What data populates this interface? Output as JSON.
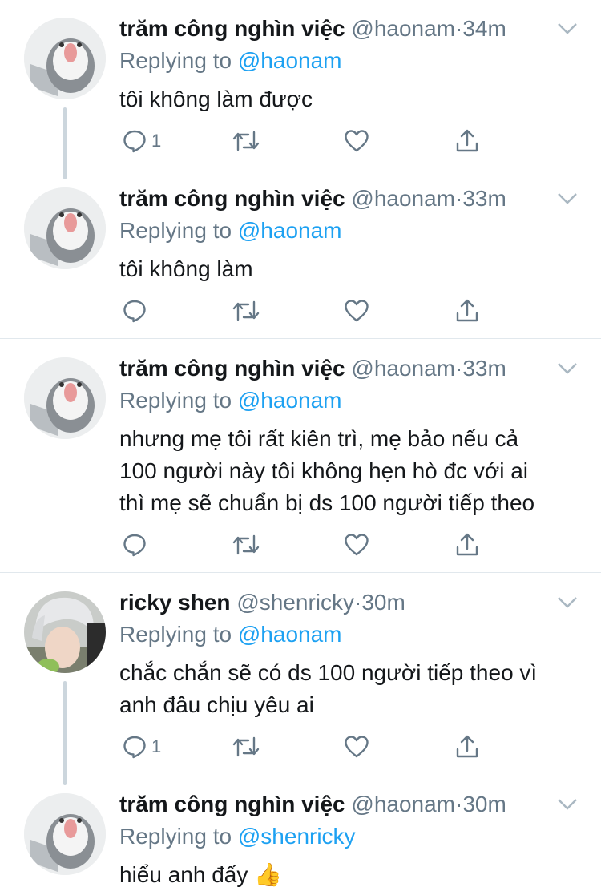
{
  "colors": {
    "text": "#14171a",
    "secondary": "#657786",
    "link": "#1da1f2",
    "divider": "#e1e8ed",
    "thread_line": "#ccd6dd"
  },
  "icons": {
    "reply": "reply-icon",
    "retweet": "retweet-icon",
    "like": "heart-icon",
    "share": "share-icon",
    "caret": "chevron-down-icon"
  },
  "tweets": [
    {
      "name": "trăm công nghìn việc",
      "handle": "@haonam",
      "dot": "·",
      "time": "34m",
      "replying_prefix": "Replying to",
      "replying_to": "@haonam",
      "lines": [
        "tôi không làm được"
      ],
      "reply_count": "1"
    },
    {
      "name": "trăm công nghìn việc",
      "handle": "@haonam",
      "dot": "·",
      "time": "33m",
      "replying_prefix": "Replying to",
      "replying_to": "@haonam",
      "lines": [
        "tôi không làm"
      ],
      "reply_count": ""
    },
    {
      "name": "trăm công nghìn việc",
      "handle": "@haonam",
      "dot": "·",
      "time": "33m",
      "replying_prefix": "Replying to",
      "replying_to": "@haonam",
      "lines": [
        "nhưng mẹ tôi rất kiên trì, mẹ bảo nếu cả",
        "100 người này tôi không hẹn hò đc với ai",
        "thì mẹ sẽ chuẩn bị ds 100 người tiếp theo"
      ],
      "reply_count": ""
    },
    {
      "name": "ricky shen",
      "handle": "@shenricky",
      "dot": "·",
      "time": "30m",
      "replying_prefix": "Replying to",
      "replying_to": "@haonam",
      "lines": [
        "chắc chắn sẽ có ds 100 người tiếp theo vì",
        "anh đâu chịu yêu ai"
      ],
      "reply_count": "1"
    },
    {
      "name": "trăm công nghìn việc",
      "handle": "@haonam",
      "dot": "·",
      "time": "30m",
      "replying_prefix": "Replying to",
      "replying_to": "@shenricky",
      "lines": [
        "hiểu anh đấy 👍"
      ],
      "reply_count": ""
    }
  ]
}
